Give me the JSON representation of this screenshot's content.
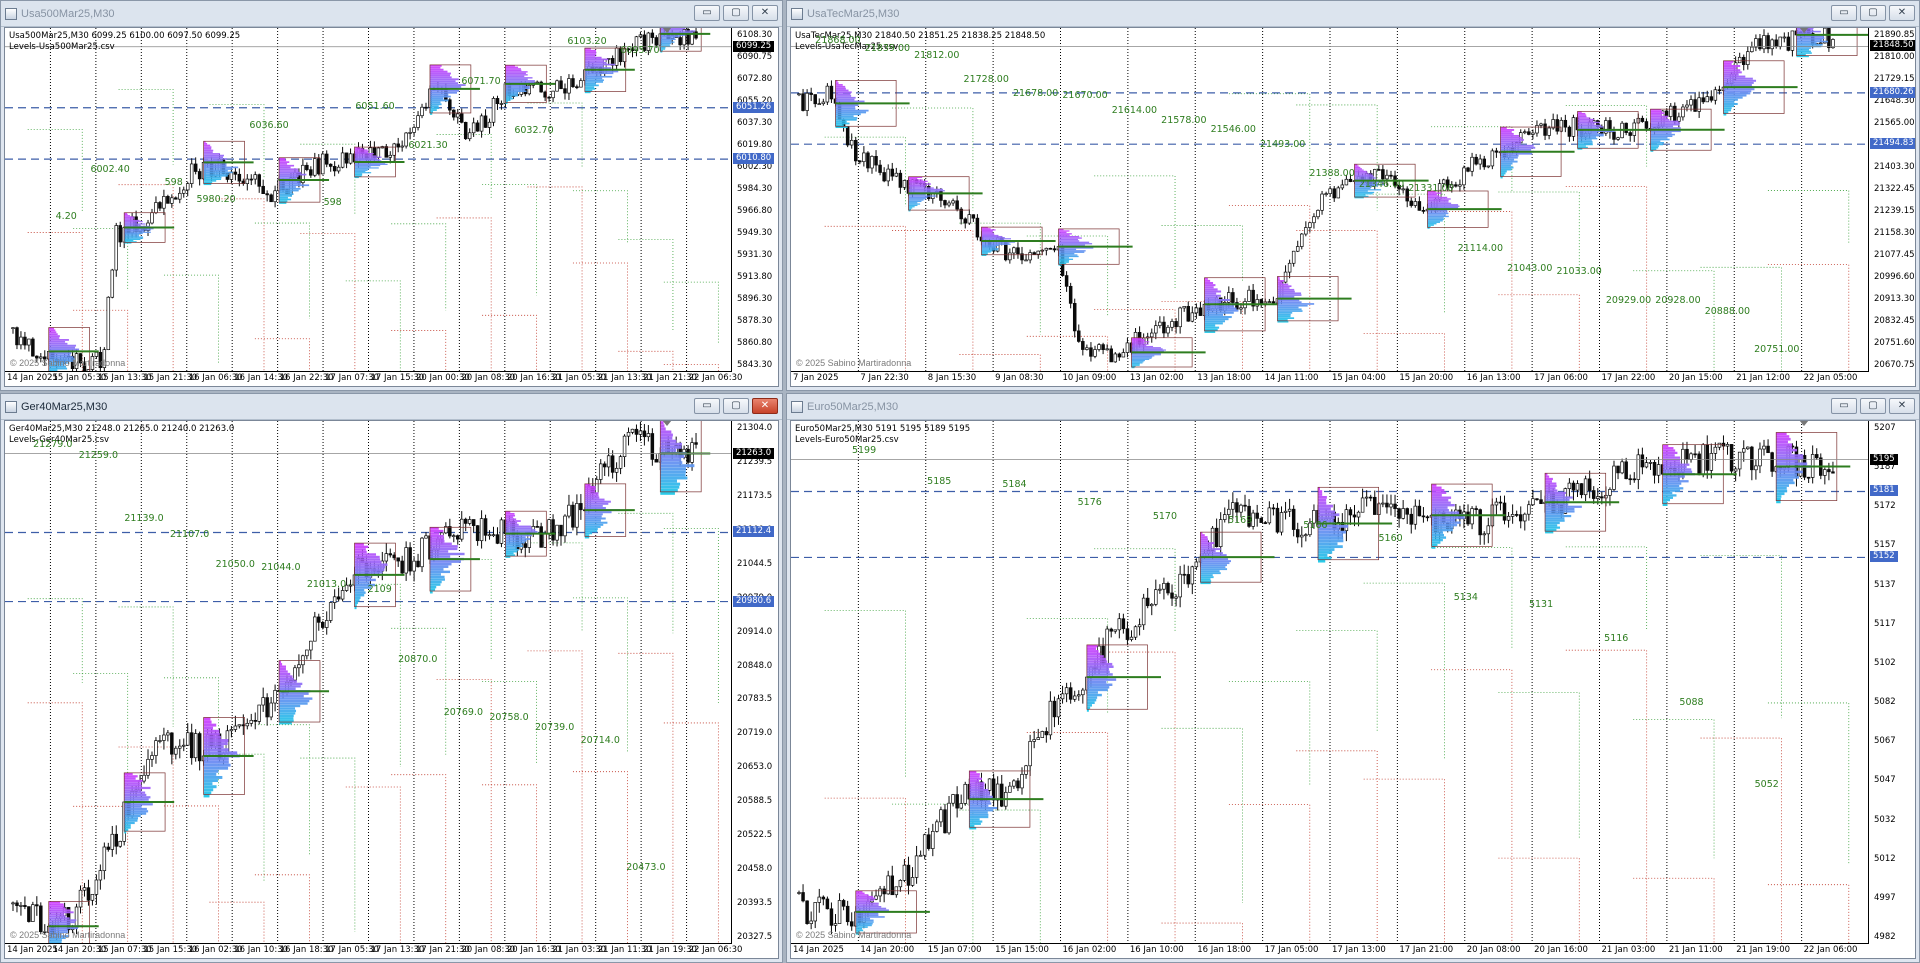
{
  "windows": [
    {
      "id": "usa500",
      "title": "Usa500Mar25,M30",
      "active": false,
      "close_red": false,
      "header_line": "Usa500Mar25,M30  6099.25 6100.00 6097.50 6099.25",
      "indicator_line": "Levels-Usa500Mar25.csv",
      "copyright": "© 2025 Sabino Martiradonna",
      "y_min": 5843.3,
      "y_max": 6114,
      "y_ticks": [
        "6108.30",
        "6090.75",
        "6072.80",
        "6055.20",
        "6037.30",
        "6019.80",
        "6002.30",
        "5984.30",
        "5966.80",
        "5949.30",
        "5931.30",
        "5913.80",
        "5896.30",
        "5878.30",
        "5860.80",
        "5843.30"
      ],
      "x_ticks": [
        "14 Jan 2025",
        "15 Jan 05:30",
        "15 Jan 13:30",
        "15 Jan 21:30",
        "16 Jan 06:30",
        "16 Jan 14:30",
        "16 Jan 22:30",
        "17 Jan 07:30",
        "17 Jan 15:30",
        "20 Jan 00:30",
        "20 Jan 08:30",
        "20 Jan 16:30",
        "21 Jan 05:30",
        "21 Jan 13:30",
        "21 Jan 21:30",
        "22 Jan 06:30"
      ],
      "price_tags": [
        {
          "text": "6099.25",
          "value": 6099.25,
          "kind": "black"
        },
        {
          "text": "6051.26",
          "value": 6051.26,
          "kind": "blue"
        },
        {
          "text": "6010.80",
          "value": 6010.8,
          "kind": "blue"
        }
      ],
      "level_labels": [
        {
          "text": "4.20",
          "value": 5965
        },
        {
          "text": "6002.40",
          "value": 6002.4
        },
        {
          "text": "598",
          "value": 5992
        },
        {
          "text": "5980.20",
          "value": 5979
        },
        {
          "text": "6036.60",
          "value": 6036.6
        },
        {
          "text": "598",
          "value": 5976
        },
        {
          "text": "6051.60",
          "value": 6051.6
        },
        {
          "text": "6021.30",
          "value": 6021.3
        },
        {
          "text": "6071.70",
          "value": 6071.7
        },
        {
          "text": "6032.70",
          "value": 6032.7
        },
        {
          "text": "6103.20",
          "value": 6103.2
        },
        {
          "text": "6095.70",
          "value": 6095.7
        }
      ],
      "dashed_levels": [
        6051.26,
        6010.8
      ]
    },
    {
      "id": "usatec",
      "title": "UsaTecMar25,M30",
      "active": false,
      "close_red": false,
      "header_line": "UsaTecMar25,M30  21840.50 21851.25 21838.25 21848.50",
      "indicator_line": "Levels-UsaTecMar25.csv",
      "copyright": "© 2025 Sabino Martiradonna",
      "y_min": 20670.75,
      "y_max": 21915,
      "y_ticks": [
        "21890.85",
        "21810.00",
        "21729.15",
        "21648.30",
        "21565.00",
        "21484.15",
        "21403.30",
        "21322.45",
        "21239.15",
        "21158.30",
        "21077.45",
        "20996.60",
        "20913.30",
        "20832.45",
        "20751.60",
        "20670.75"
      ],
      "x_ticks": [
        "7 Jan 2025",
        "7 Jan 22:30",
        "8 Jan 15:30",
        "9 Jan 08:30",
        "10 Jan 09:00",
        "13 Jan 02:00",
        "13 Jan 18:00",
        "14 Jan 11:00",
        "15 Jan 04:00",
        "15 Jan 20:00",
        "16 Jan 13:00",
        "17 Jan 06:00",
        "17 Jan 22:00",
        "20 Jan 15:00",
        "21 Jan 12:00",
        "22 Jan 05:00"
      ],
      "price_tags": [
        {
          "text": "21848.50",
          "value": 21848.5,
          "kind": "black"
        },
        {
          "text": "21680.26",
          "value": 21680.26,
          "kind": "blue"
        },
        {
          "text": "21494.83",
          "value": 21494.83,
          "kind": "blue"
        }
      ],
      "level_labels": [
        {
          "text": "21868.00",
          "value": 21868
        },
        {
          "text": "21839.00",
          "value": 21839
        },
        {
          "text": "21812.00",
          "value": 21812
        },
        {
          "text": "21728.00",
          "value": 21728
        },
        {
          "text": "21678.00",
          "value": 21678
        },
        {
          "text": "21670.00",
          "value": 21670
        },
        {
          "text": "21614.00",
          "value": 21614
        },
        {
          "text": "21578.00",
          "value": 21578
        },
        {
          "text": "21546.00",
          "value": 21546
        },
        {
          "text": "21493.00",
          "value": 21493
        },
        {
          "text": "21388.00",
          "value": 21388
        },
        {
          "text": "21346.00",
          "value": 21346
        },
        {
          "text": "21331.00",
          "value": 21331
        },
        {
          "text": "21114.00",
          "value": 21114
        },
        {
          "text": "21043.00",
          "value": 21043
        },
        {
          "text": "21033.00",
          "value": 21033
        },
        {
          "text": "20929.00",
          "value": 20929
        },
        {
          "text": "20928.00",
          "value": 20928
        },
        {
          "text": "20888.00",
          "value": 20888
        },
        {
          "text": "20751.00",
          "value": 20751
        }
      ],
      "dashed_levels": [
        21680.26,
        21494.83
      ]
    },
    {
      "id": "ger40",
      "title": "Ger40Mar25,M30",
      "active": true,
      "close_red": true,
      "header_line": "Ger40Mar25,M30  21248.0 21265.0 21240.0 21263.0",
      "indicator_line": "Levels-Ger40Mar25.csv",
      "copyright": "© 2025 Sabino Martiradonna",
      "y_min": 20327.5,
      "y_max": 21325,
      "y_ticks": [
        "21304.0",
        "21239.5",
        "21173.5",
        "21109.0",
        "21044.5",
        "20979.0",
        "20914.0",
        "20848.0",
        "20783.5",
        "20719.0",
        "20653.0",
        "20588.5",
        "20522.5",
        "20458.0",
        "20393.5",
        "20327.5"
      ],
      "x_ticks": [
        "14 Jan 2025",
        "14 Jan 20:30",
        "15 Jan 07:30",
        "15 Jan 15:30",
        "16 Jan 02:30",
        "16 Jan 10:30",
        "16 Jan 18:30",
        "17 Jan 05:30",
        "17 Jan 13:30",
        "17 Jan 21:30",
        "20 Jan 08:30",
        "20 Jan 16:30",
        "21 Jan 03:30",
        "21 Jan 11:30",
        "21 Jan 19:30",
        "22 Jan 06:30"
      ],
      "price_tags": [
        {
          "text": "21263.0",
          "value": 21263,
          "kind": "black"
        },
        {
          "text": "21112.4",
          "value": 21112.4,
          "kind": "blue"
        },
        {
          "text": "20980.6",
          "value": 20980.6,
          "kind": "blue"
        }
      ],
      "level_labels": [
        {
          "text": "21279.0",
          "value": 21279
        },
        {
          "text": "21259.0",
          "value": 21259
        },
        {
          "text": "21139.0",
          "value": 21139
        },
        {
          "text": "21107.0",
          "value": 21107
        },
        {
          "text": "21050.0",
          "value": 21050
        },
        {
          "text": "21044.0",
          "value": 21044
        },
        {
          "text": "21013.0",
          "value": 21013
        },
        {
          "text": "2109",
          "value": 21002
        },
        {
          "text": "20870.0",
          "value": 20870
        },
        {
          "text": "20769.0",
          "value": 20769
        },
        {
          "text": "20758.0",
          "value": 20758
        },
        {
          "text": "20739.0",
          "value": 20739
        },
        {
          "text": "20714.0",
          "value": 20714
        },
        {
          "text": "20473.0",
          "value": 20473
        }
      ],
      "dashed_levels": [
        21112.4,
        20980.6
      ]
    },
    {
      "id": "euro50",
      "title": "Euro50Mar25,M30",
      "active": false,
      "close_red": false,
      "header_line": "Euro50Mar25,M30  5191 5195 5189 5195",
      "indicator_line": "Levels-Euro50Mar25.csv",
      "copyright": "© 2025 Sabino Martiradonna",
      "y_min": 4982,
      "y_max": 5212,
      "y_ticks": [
        "5207",
        "5187",
        "5172",
        "5157",
        "5137",
        "5117",
        "5102",
        "5082",
        "5067",
        "5047",
        "5032",
        "5012",
        "4997",
        "4982"
      ],
      "x_ticks": [
        "14 Jan 2025",
        "14 Jan 20:00",
        "15 Jan 07:00",
        "15 Jan 15:00",
        "16 Jan 02:00",
        "16 Jan 10:00",
        "16 Jan 18:00",
        "17 Jan 05:00",
        "17 Jan 13:00",
        "17 Jan 21:00",
        "20 Jan 08:00",
        "20 Jan 16:00",
        "21 Jan 03:00",
        "21 Jan 11:00",
        "21 Jan 19:00",
        "22 Jan 06:00"
      ],
      "price_tags": [
        {
          "text": "5195",
          "value": 5195,
          "kind": "black"
        },
        {
          "text": "5181",
          "value": 5181,
          "kind": "blue"
        },
        {
          "text": "5152",
          "value": 5152,
          "kind": "blue"
        }
      ],
      "level_labels": [
        {
          "text": "5199",
          "value": 5199
        },
        {
          "text": "5185",
          "value": 5185
        },
        {
          "text": "5184",
          "value": 5184
        },
        {
          "text": "5176",
          "value": 5176
        },
        {
          "text": "5170",
          "value": 5170
        },
        {
          "text": "5169",
          "value": 5168
        },
        {
          "text": "5166",
          "value": 5166
        },
        {
          "text": "5160",
          "value": 5160
        },
        {
          "text": "5134",
          "value": 5134
        },
        {
          "text": "5131",
          "value": 5131
        },
        {
          "text": "5116",
          "value": 5116
        },
        {
          "text": "5088",
          "value": 5088
        },
        {
          "text": "5052",
          "value": 5052
        }
      ],
      "dashed_levels": [
        5181,
        5152
      ]
    }
  ],
  "colors": {
    "candle": "#0a0a0a",
    "level_text": "#2e7d1f",
    "dashed_level": "#3d5ea8",
    "profile_top": "#d040ff",
    "profile_bottom": "#20c8e8",
    "value_area": "#2e7d1f",
    "lower_step": "#d9745a"
  },
  "window_buttons": {
    "minimize": "▭",
    "maximize": "▢",
    "close": "✕"
  }
}
